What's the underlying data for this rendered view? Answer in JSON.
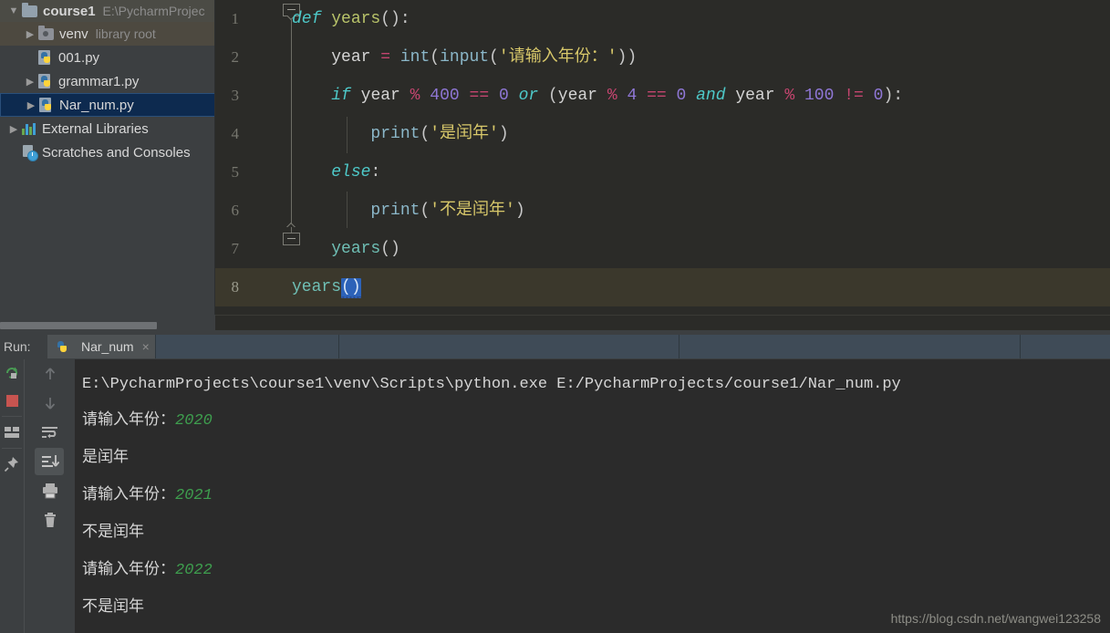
{
  "sidebar": {
    "items": [
      {
        "label": "course1",
        "secondary": "E:\\PycharmProjec",
        "icon": "folder-icon",
        "arrow": "down",
        "selected": false
      },
      {
        "label": "venv",
        "secondary": "library root",
        "icon": "folder-venv-icon",
        "arrow": "right",
        "selected": false
      },
      {
        "label": "001.py",
        "secondary": "",
        "icon": "python-file-icon",
        "arrow": "none",
        "selected": false
      },
      {
        "label": "grammar1.py",
        "secondary": "",
        "icon": "python-file-icon",
        "arrow": "right",
        "selected": false
      },
      {
        "label": "Nar_num.py",
        "secondary": "",
        "icon": "python-file-icon",
        "arrow": "right",
        "selected": true
      },
      {
        "label": "External Libraries",
        "secondary": "",
        "icon": "external-libraries-icon",
        "arrow": "right",
        "selected": false
      },
      {
        "label": "Scratches and Consoles",
        "secondary": "",
        "icon": "scratches-icon",
        "arrow": "none",
        "selected": false
      }
    ]
  },
  "editor": {
    "lines": [
      {
        "number": "1",
        "tokens": [
          {
            "t": "def",
            "c": "kw"
          },
          {
            "t": " ",
            "c": "punc"
          },
          {
            "t": "years",
            "c": "fn"
          },
          {
            "t": "()",
            "c": "punc"
          },
          {
            "t": ":",
            "c": "punc"
          }
        ]
      },
      {
        "number": "2",
        "tokens": [
          {
            "t": "    ",
            "c": "punc"
          },
          {
            "t": "year",
            "c": "ident"
          },
          {
            "t": " ",
            "c": "punc"
          },
          {
            "t": "=",
            "c": "op"
          },
          {
            "t": " ",
            "c": "punc"
          },
          {
            "t": "int",
            "c": "builtin"
          },
          {
            "t": "(",
            "c": "punc"
          },
          {
            "t": "input",
            "c": "builtin"
          },
          {
            "t": "(",
            "c": "punc"
          },
          {
            "t": "'请输入年份：'",
            "c": "str"
          },
          {
            "t": "))",
            "c": "punc"
          }
        ]
      },
      {
        "number": "3",
        "tokens": [
          {
            "t": "    ",
            "c": "punc"
          },
          {
            "t": "if",
            "c": "kw"
          },
          {
            "t": " ",
            "c": "punc"
          },
          {
            "t": "year",
            "c": "ident"
          },
          {
            "t": " ",
            "c": "punc"
          },
          {
            "t": "%",
            "c": "op"
          },
          {
            "t": " ",
            "c": "punc"
          },
          {
            "t": "400",
            "c": "num-lit"
          },
          {
            "t": " ",
            "c": "punc"
          },
          {
            "t": "==",
            "c": "op"
          },
          {
            "t": " ",
            "c": "punc"
          },
          {
            "t": "0",
            "c": "num-lit"
          },
          {
            "t": " ",
            "c": "punc"
          },
          {
            "t": "or",
            "c": "kw"
          },
          {
            "t": " (",
            "c": "punc"
          },
          {
            "t": "year",
            "c": "ident"
          },
          {
            "t": " ",
            "c": "punc"
          },
          {
            "t": "%",
            "c": "op"
          },
          {
            "t": " ",
            "c": "punc"
          },
          {
            "t": "4",
            "c": "num-lit"
          },
          {
            "t": " ",
            "c": "punc"
          },
          {
            "t": "==",
            "c": "op"
          },
          {
            "t": " ",
            "c": "punc"
          },
          {
            "t": "0",
            "c": "num-lit"
          },
          {
            "t": " ",
            "c": "punc"
          },
          {
            "t": "and",
            "c": "kw"
          },
          {
            "t": " ",
            "c": "punc"
          },
          {
            "t": "year",
            "c": "ident"
          },
          {
            "t": " ",
            "c": "punc"
          },
          {
            "t": "%",
            "c": "op"
          },
          {
            "t": " ",
            "c": "punc"
          },
          {
            "t": "100",
            "c": "num-lit"
          },
          {
            "t": " ",
            "c": "punc"
          },
          {
            "t": "!=",
            "c": "op"
          },
          {
            "t": " ",
            "c": "punc"
          },
          {
            "t": "0",
            "c": "num-lit"
          },
          {
            "t": "):",
            "c": "punc"
          }
        ]
      },
      {
        "number": "4",
        "tokens": [
          {
            "t": "        ",
            "c": "punc"
          },
          {
            "t": "print",
            "c": "builtin"
          },
          {
            "t": "(",
            "c": "punc"
          },
          {
            "t": "'是闰年'",
            "c": "str"
          },
          {
            "t": ")",
            "c": "punc"
          }
        ]
      },
      {
        "number": "5",
        "tokens": [
          {
            "t": "    ",
            "c": "punc"
          },
          {
            "t": "else",
            "c": "kw"
          },
          {
            "t": ":",
            "c": "punc"
          }
        ]
      },
      {
        "number": "6",
        "tokens": [
          {
            "t": "        ",
            "c": "punc"
          },
          {
            "t": "print",
            "c": "builtin"
          },
          {
            "t": "(",
            "c": "punc"
          },
          {
            "t": "'不是闰年'",
            "c": "str"
          },
          {
            "t": ")",
            "c": "punc"
          }
        ]
      },
      {
        "number": "7",
        "tokens": [
          {
            "t": "    ",
            "c": "punc"
          },
          {
            "t": "years",
            "c": "callname"
          },
          {
            "t": "()",
            "c": "punc"
          }
        ]
      },
      {
        "number": "8",
        "current": true,
        "tokens": [
          {
            "t": "years",
            "c": "callname"
          },
          {
            "t": "()",
            "c": "sel-token"
          }
        ]
      }
    ]
  },
  "run_panel": {
    "label": "Run:",
    "tab_title": "Nar_num",
    "tab_close": "×",
    "toolbar_left": [
      "rerun-icon",
      "stop-icon",
      "layout-icon",
      "pin-icon"
    ],
    "toolbar_right": [
      "arrow-up-icon",
      "arrow-down-icon",
      "soft-wrap-icon",
      "scroll-to-end-icon",
      "print-icon",
      "trash-icon"
    ]
  },
  "console": {
    "lines": [
      {
        "segments": [
          {
            "t": "E:\\PycharmProjects\\course1\\venv\\Scripts\\python.exe E:/PycharmProjects/course1/Nar_num.py",
            "c": "out"
          }
        ]
      },
      {
        "segments": [
          {
            "t": "请输入年份：",
            "c": "out"
          },
          {
            "t": "2020",
            "c": "cin"
          }
        ]
      },
      {
        "segments": [
          {
            "t": "是闰年",
            "c": "out"
          }
        ]
      },
      {
        "segments": [
          {
            "t": "请输入年份：",
            "c": "out"
          },
          {
            "t": "2021",
            "c": "cin"
          }
        ]
      },
      {
        "segments": [
          {
            "t": "不是闰年",
            "c": "out"
          }
        ]
      },
      {
        "segments": [
          {
            "t": "请输入年份：",
            "c": "out"
          },
          {
            "t": "2022",
            "c": "cin"
          }
        ]
      },
      {
        "segments": [
          {
            "t": "不是闰年",
            "c": "out"
          }
        ]
      }
    ]
  },
  "watermark": "https://blog.csdn.net/wangwei123258",
  "colors": {
    "editor_bg": "#2b2b28",
    "console_bg": "#2b2b2b",
    "panel_bg": "#3c3f41",
    "selection_blue": "#2c62b8",
    "sidebar_selected": "#0d2a4f",
    "current_line": "#3b382c",
    "console_input_green": "#3e9e4e",
    "string_yellow": "#d8c86a",
    "keyword_cyan": "#4ec9c9",
    "number_purple": "#8f77d6",
    "operator_pink": "#c4456f"
  }
}
